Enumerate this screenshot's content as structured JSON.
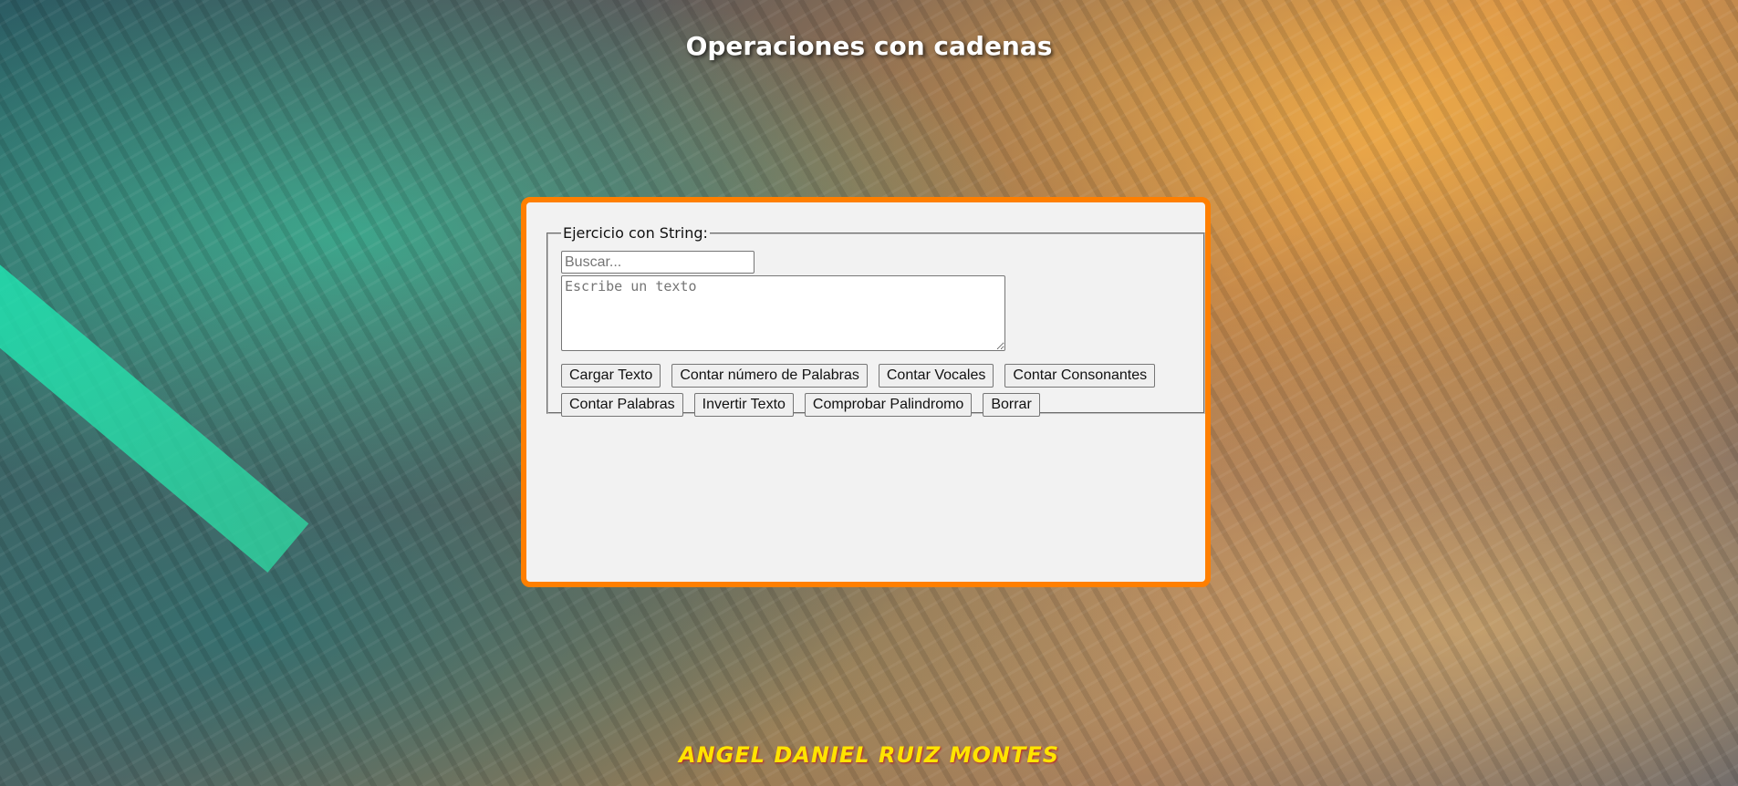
{
  "page": {
    "title": "Operaciones con cadenas",
    "footer": "ANGEL DANIEL RUIZ MONTES"
  },
  "form": {
    "legend": "Ejercicio con String:",
    "search_placeholder": "Buscar...",
    "search_value": "",
    "textarea_placeholder": "Escribe un texto",
    "textarea_value": ""
  },
  "buttons": {
    "load": "Cargar Texto",
    "count_number_words": "Contar número de Palabras",
    "count_vowels": "Contar Vocales",
    "count_consonants": "Contar Consonantes",
    "count_words": "Contar Palabras",
    "reverse": "Invertir Texto",
    "palindrome": "Comprobar Palindromo",
    "clear": "Borrar"
  },
  "colors": {
    "card_border": "#ff7f00",
    "card_background": "#f2f2f2",
    "footer_text": "#ffe400",
    "title_text": "#ffffff"
  }
}
